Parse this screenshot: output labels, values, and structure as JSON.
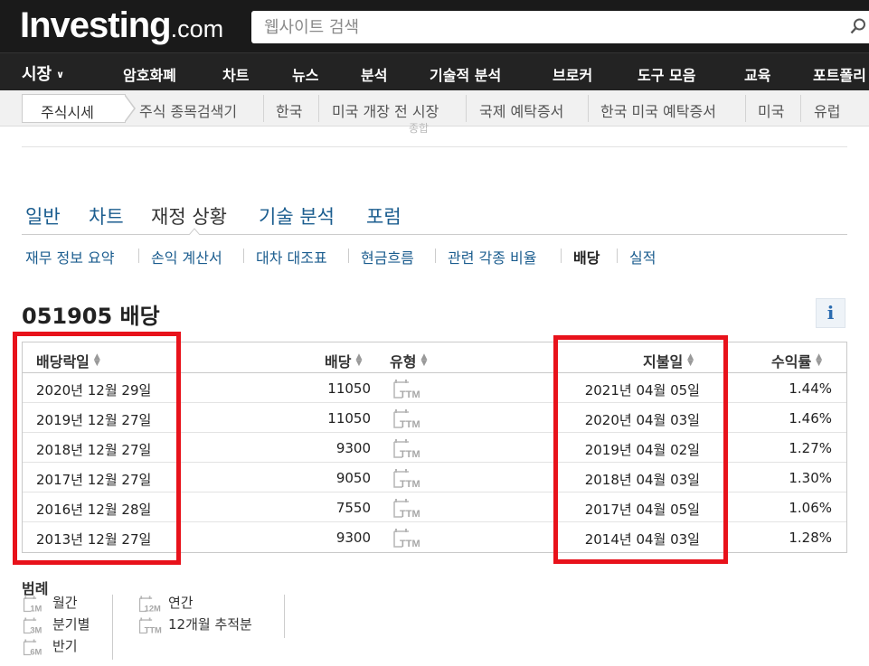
{
  "header": {
    "logo_main": "Investing",
    "logo_suffix": ".com",
    "search_placeholder": "웹사이트 검색"
  },
  "main_nav": [
    "시장",
    "암호화폐",
    "차트",
    "뉴스",
    "분석",
    "기술적 분석",
    "브로커",
    "도구 모음",
    "교육",
    "포트폴리"
  ],
  "sub_nav": {
    "current": "주식시세",
    "items": [
      "주식 종목검색기",
      "한국",
      "미국 개장 전 시장",
      "국제 예탁증서",
      "한국 미국 예탁증서",
      "미국",
      "유럽"
    ]
  },
  "faint_text": "종합",
  "tabs": [
    "일반",
    "차트",
    "재정 상황",
    "기술 분석",
    "포럼"
  ],
  "active_tab": "재정 상황",
  "sub_tabs": [
    "재무 정보 요약",
    "손익 계산서",
    "대차 대조표",
    "현금흐름",
    "관련 각종 비율",
    "배당",
    "실적"
  ],
  "active_sub_tab": "배당",
  "page_title": "051905 배당",
  "table": {
    "headers": {
      "ex_date": "배당락일",
      "dividend": "배당",
      "type": "유형",
      "pay_date": "지불일",
      "yield": "수익률"
    },
    "rows": [
      {
        "ex_date": "2020년 12월 29일",
        "dividend": "11050",
        "type": "TTM",
        "pay_date": "2021년 04월 05일",
        "yield": "1.44%"
      },
      {
        "ex_date": "2019년 12월 27일",
        "dividend": "11050",
        "type": "TTM",
        "pay_date": "2020년 04월 03일",
        "yield": "1.46%"
      },
      {
        "ex_date": "2018년 12월 27일",
        "dividend": "9300",
        "type": "TTM",
        "pay_date": "2019년 04월 02일",
        "yield": "1.27%"
      },
      {
        "ex_date": "2017년 12월 27일",
        "dividend": "9050",
        "type": "TTM",
        "pay_date": "2018년 04월 03일",
        "yield": "1.30%"
      },
      {
        "ex_date": "2016년 12월 28일",
        "dividend": "7550",
        "type": "TTM",
        "pay_date": "2017년 04월 05일",
        "yield": "1.06%"
      },
      {
        "ex_date": "2013년 12월 27일",
        "dividend": "9300",
        "type": "TTM",
        "pay_date": "2014년 04월 03일",
        "yield": "1.28%"
      }
    ]
  },
  "legend": {
    "title": "범례",
    "items": [
      {
        "code": "1M",
        "label": "월간"
      },
      {
        "code": "3M",
        "label": "분기별"
      },
      {
        "code": "6M",
        "label": "반기"
      },
      {
        "code": "12M",
        "label": "연간"
      },
      {
        "code": "TTM",
        "label": "12개월 추적분"
      }
    ]
  },
  "colors": {
    "header_bg": "#1a1a1a",
    "nav_bg": "#232323",
    "link_blue": "#1b5d8f",
    "highlight_red": "#e8121b"
  },
  "icons": [
    "search-icon",
    "chevron-down-icon",
    "info-icon",
    "sort-icon",
    "calendar-ttm-icon"
  ]
}
